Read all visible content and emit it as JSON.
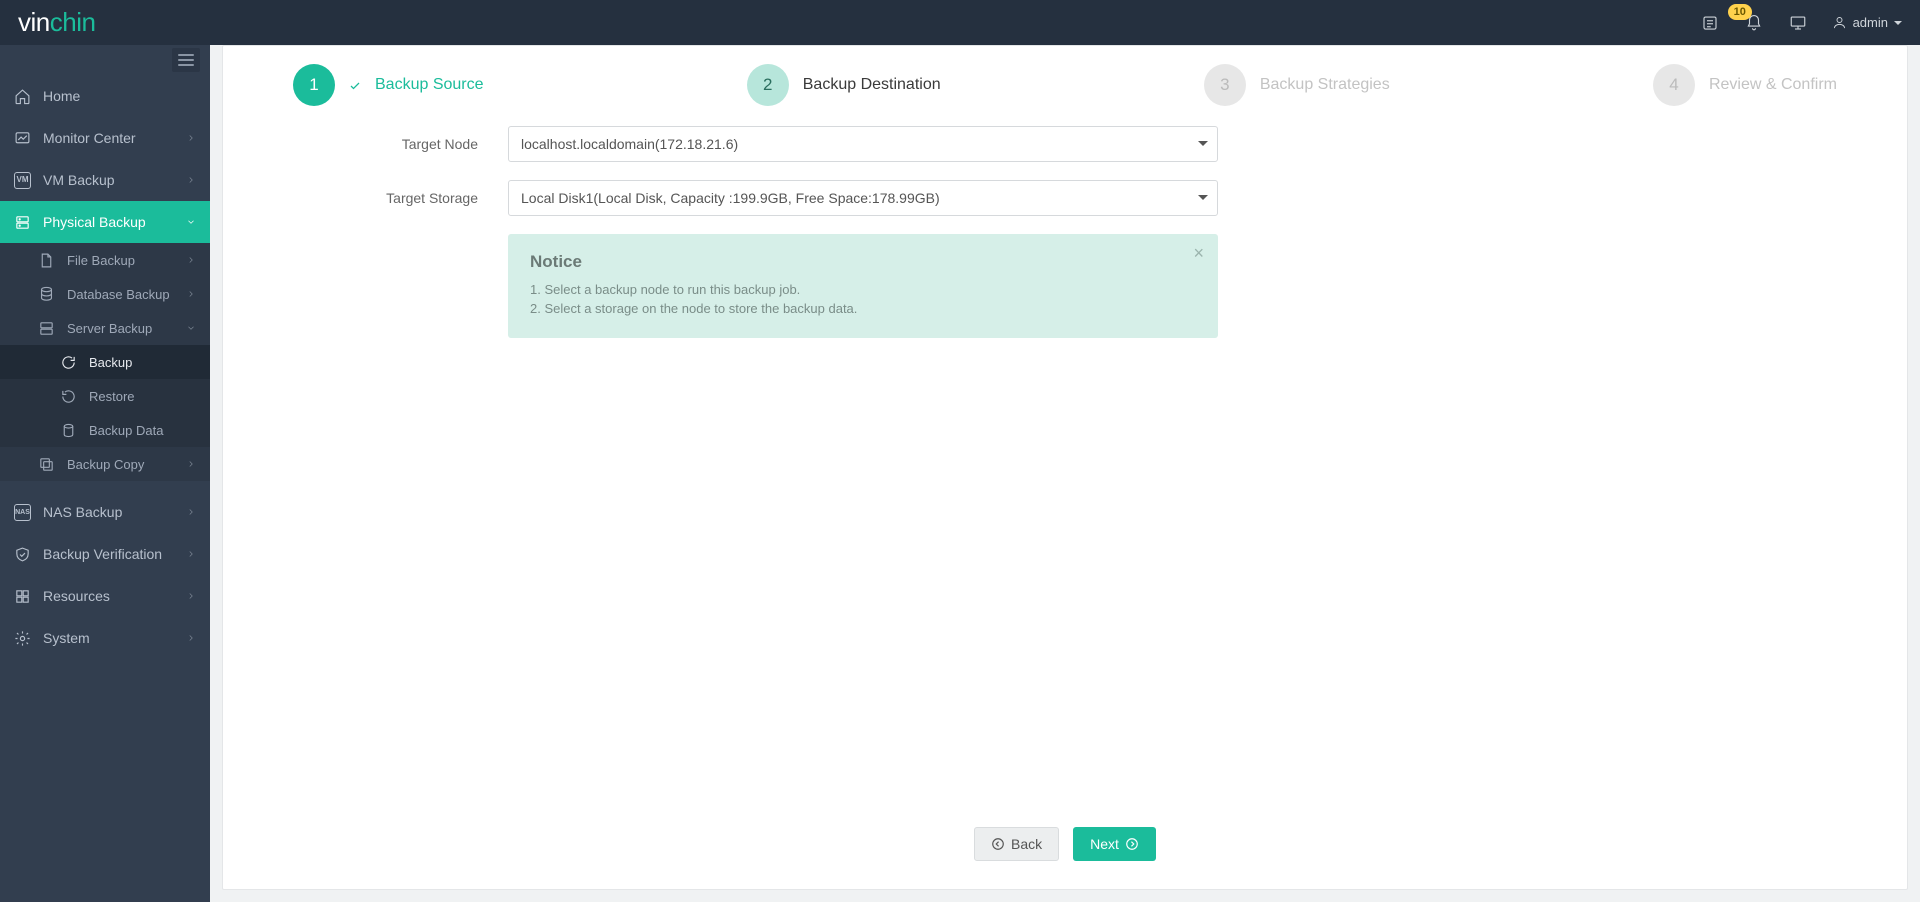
{
  "brand": {
    "pre": "vin",
    "accent": "chin"
  },
  "topbar": {
    "notif_count": "10",
    "user": "admin"
  },
  "sidebar": {
    "home": "Home",
    "monitor": "Monitor Center",
    "vm": "VM Backup",
    "physical": "Physical Backup",
    "file": "File Backup",
    "database": "Database Backup",
    "server": "Server Backup",
    "server_backup": "Backup",
    "server_restore": "Restore",
    "server_data": "Backup Data",
    "copy": "Backup Copy",
    "nas": "NAS Backup",
    "verify": "Backup Verification",
    "resources": "Resources",
    "system": "System"
  },
  "wizard": {
    "step1": "Backup Source",
    "step2": "Backup Destination",
    "step3": "Backup Strategies",
    "step4": "Review & Confirm"
  },
  "form": {
    "target_node_label": "Target Node",
    "target_node_value": "localhost.localdomain(172.18.21.6)",
    "target_storage_label": "Target Storage",
    "target_storage_value": "Local Disk1(Local Disk, Capacity :199.9GB, Free Space:178.99GB)"
  },
  "notice": {
    "title": "Notice",
    "items": [
      "1. Select a backup node to run this backup job.",
      "2. Select a storage on the node to store the backup data."
    ]
  },
  "buttons": {
    "back": "Back",
    "next": "Next"
  }
}
